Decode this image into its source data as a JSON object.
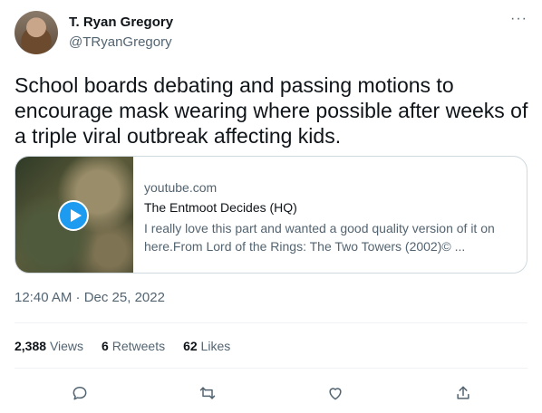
{
  "author": {
    "name": "T. Ryan Gregory",
    "handle": "@TRyanGregory"
  },
  "more_label": "···",
  "tweet": {
    "text": "School boards debating and passing motions to encourage mask wearing where possible after weeks of a triple viral outbreak affecting kids."
  },
  "card": {
    "domain": "youtube.com",
    "title": "The Entmoot Decides (HQ)",
    "description": "I really love this part and wanted a good quality version of it on here.From Lord of the Rings: The Two Towers (2002)© ..."
  },
  "timestamp": "12:40 AM · Dec 25, 2022",
  "stats": {
    "views_count": "2,388",
    "views_label": "Views",
    "retweets_count": "6",
    "retweets_label": "Retweets",
    "likes_count": "62",
    "likes_label": "Likes"
  },
  "icons": {
    "reply": "reply-icon",
    "retweet": "retweet-icon",
    "like": "like-icon",
    "share": "share-icon",
    "more": "more-icon",
    "play": "play-icon"
  },
  "colors": {
    "accent": "#1d9bf0",
    "text": "#0f1419",
    "muted": "#536471",
    "border": "#cfd9de"
  }
}
